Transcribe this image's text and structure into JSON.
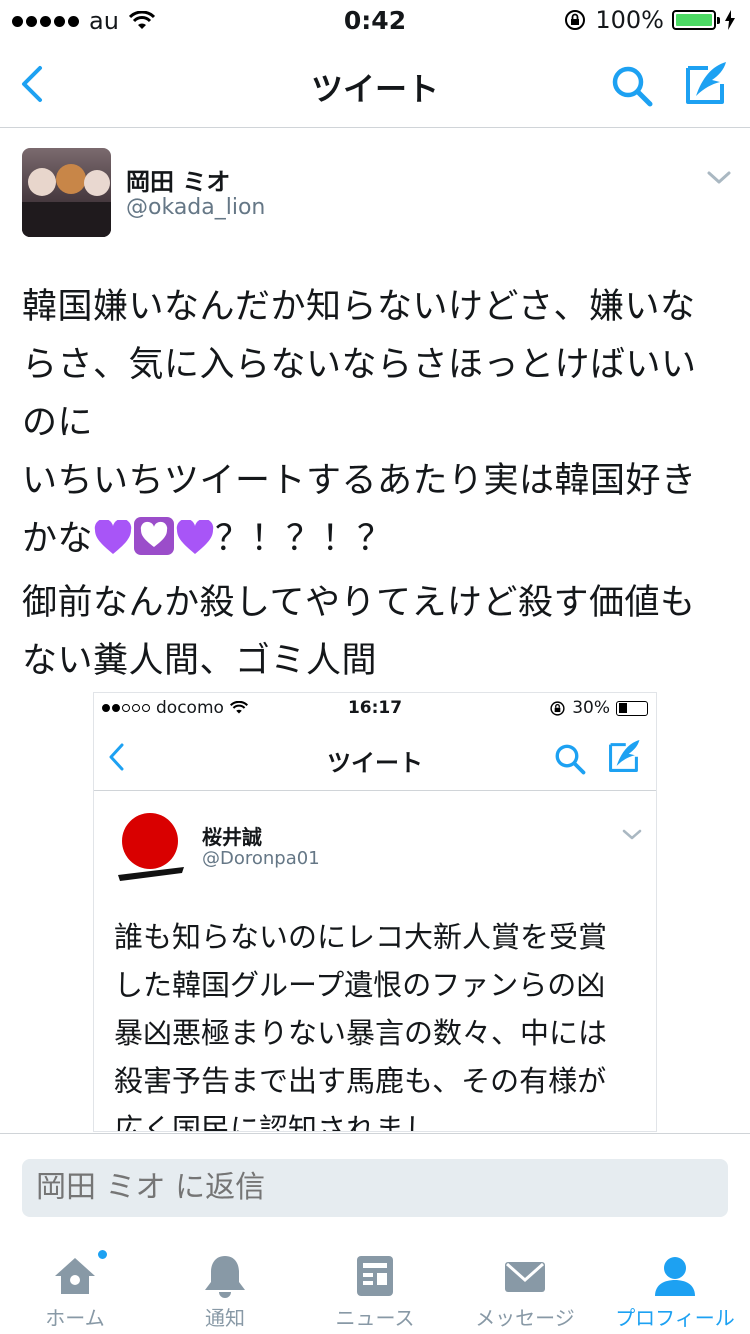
{
  "status_bar": {
    "carrier": "au",
    "time": "0:42",
    "battery_percent": "100%"
  },
  "nav": {
    "title": "ツイート",
    "back_icon": "chevron-left-icon",
    "search_icon": "search-icon",
    "compose_icon": "compose-icon"
  },
  "tweet": {
    "author_name": "岡田 ミオ",
    "author_handle": "@okada_lion",
    "text_line1": "韓国嫌いなんだか知らないけどさ、嫌いならさ、気に入らないならさほっとけばいいのに\nいちいちツイートするあたり実は韓国好きかな",
    "text_line2": "？！？！？\n御前なんか殺してやりてえけど殺す価値もない糞人間、ゴミ人間"
  },
  "embedded": {
    "status_bar": {
      "carrier": "docomo",
      "time": "16:17",
      "battery_percent": "30%"
    },
    "nav_title": "ツイート",
    "author_name": "桜井誠",
    "author_handle": "@Doronpa01",
    "text": "誰も知らないのにレコ大新人賞を受賞した韓国グループ遺恨のファンらの凶暴凶悪極まりない暴言の数々、中には殺害予告まで出す馬鹿も、その有様が広く国民に認知されまし"
  },
  "reply": {
    "placeholder": "岡田 ミオ に返信"
  },
  "tabs": [
    {
      "label": "ホーム",
      "icon": "home-icon"
    },
    {
      "label": "通知",
      "icon": "bell-icon"
    },
    {
      "label": "ニュース",
      "icon": "news-icon"
    },
    {
      "label": "メッセージ",
      "icon": "envelope-icon"
    },
    {
      "label": "プロフィール",
      "icon": "profile-icon"
    }
  ],
  "colors": {
    "accent": "#1da1f2",
    "muted": "#8899a6",
    "battery_green": "#4cd964",
    "heart_purple": "#a855f7"
  }
}
